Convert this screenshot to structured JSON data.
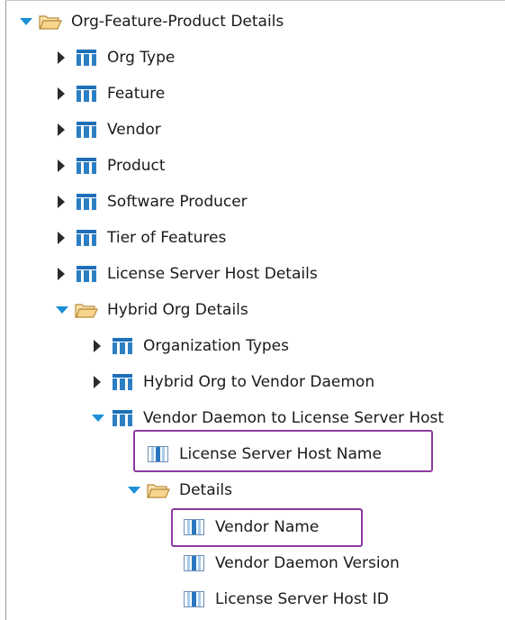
{
  "tree": {
    "root": "Org-Feature-Product Details",
    "org_type": "Org Type",
    "feature": "Feature",
    "vendor": "Vendor",
    "product": "Product",
    "software_producer": "Software Producer",
    "tier_of_features": "Tier of Features",
    "license_server_host_details": "License Server Host Details",
    "hybrid_org_details": "Hybrid Org Details",
    "organization_types": "Organization Types",
    "hybrid_org_to_vendor_daemon": "Hybrid Org to Vendor Daemon",
    "vendor_daemon_to_lsh": "Vendor Daemon to License Server Host",
    "license_server_host_name": "License Server Host Name",
    "details": "Details",
    "vendor_name": "Vendor Name",
    "vendor_daemon_version": "Vendor Daemon Version",
    "license_server_host_id": "License Server Host ID"
  },
  "colors": {
    "folder": "#f4c775",
    "table_icon": "#1e6fb8",
    "expander_open": "#1b8fd8",
    "highlight": "#8b3a9e"
  }
}
